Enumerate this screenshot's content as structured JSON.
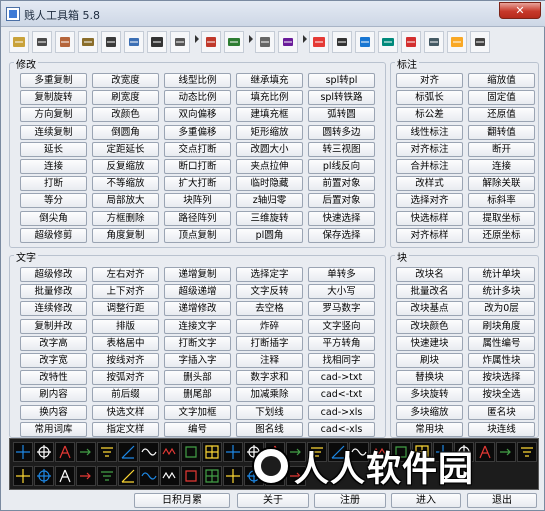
{
  "window": {
    "title": "贱人工具箱 5.8",
    "close_glyph": "✕"
  },
  "toolbar": {
    "icons": [
      "open-folder-icon",
      "print-icon",
      "stamp-icon",
      "lock-icon",
      "printer-icon",
      "calculator-icon",
      "zoom-icon",
      "ruler-icon",
      "layer-icon",
      "export-icon",
      "dimension-icon",
      "mark-icon",
      "color-palette-icon",
      "edit-icon",
      "screen-icon",
      "book-icon",
      "magnet-icon",
      "crosshair-icon",
      "gear-icon",
      "keyboard-icon"
    ]
  },
  "sections": {
    "modify": {
      "title": "修改",
      "rows": [
        [
          "多重复制",
          "改宽度",
          "线型比例",
          "继承填充",
          "spl转pl"
        ],
        [
          "复制旋转",
          "刷宽度",
          "动态比例",
          "填充比例",
          "spl转铁路"
        ],
        [
          "方向复制",
          "改颜色",
          "双向偏移",
          "建填充框",
          "弧转圆"
        ],
        [
          "连续复制",
          "倒圆角",
          "多重偏移",
          "矩形缩放",
          "圆转多边"
        ],
        [
          "延长",
          "定距延长",
          "交点打断",
          "改圆大小",
          "转三视图"
        ],
        [
          "连接",
          "反复缩放",
          "断口打断",
          "夹点拉伸",
          "pl线反向"
        ],
        [
          "打断",
          "不等缩放",
          "扩大打断",
          "临时隐藏",
          "前置对象"
        ],
        [
          "等分",
          "局部放大",
          "块阵列",
          "z轴归零",
          "后置对象"
        ],
        [
          "倒尖角",
          "方框删除",
          "路径阵列",
          "三维旋转",
          "快速选择"
        ],
        [
          "超级修剪",
          "角度复制",
          "顶点复制",
          "pl圆角",
          "保存选择"
        ]
      ]
    },
    "annotate": {
      "title": "标注",
      "rows": [
        [
          "对齐",
          "缩放值"
        ],
        [
          "标弧长",
          "固定值"
        ],
        [
          "标公差",
          "还原值"
        ],
        [
          "线性标注",
          "翻转值"
        ],
        [
          "对齐标注",
          "断开"
        ],
        [
          "合并标注",
          "连接"
        ],
        [
          "改样式",
          "解除关联"
        ],
        [
          "选择对齐",
          "标斜率"
        ],
        [
          "快选标样",
          "提取坐标"
        ],
        [
          "对齐标样",
          "还原坐标"
        ]
      ]
    },
    "text": {
      "title": "文字",
      "rows": [
        [
          "超级修改",
          "左右对齐",
          "递增复制",
          "选择定字",
          "单转多"
        ],
        [
          "批量修改",
          "上下对齐",
          "超级递增",
          "文字反转",
          "大小写"
        ],
        [
          "连续修改",
          "调整行距",
          "递增修改",
          "去空格",
          "罗马数字"
        ],
        [
          "复制并改",
          "排版",
          "连接文字",
          "炸碎",
          "文字竖向"
        ],
        [
          "改字高",
          "表格居中",
          "打断文字",
          "打断插字",
          "平方转角"
        ],
        [
          "改字宽",
          "按线对齐",
          "字插入字",
          "注释",
          "找相同字"
        ],
        [
          "改特性",
          "按弧对齐",
          "删头部",
          "数字求和",
          "cad->txt"
        ],
        [
          "刷内容",
          "前后缀",
          "删尾部",
          "加减乘除",
          "cad<-txt"
        ],
        [
          "换内容",
          "快选文样",
          "文字加框",
          "下划线",
          "cad->xls"
        ],
        [
          "常用词库",
          "指定文样",
          "编号",
          "图名线",
          "cad<-xls"
        ]
      ]
    },
    "block": {
      "title": "块",
      "rows": [
        [
          "改块名",
          "统计单块"
        ],
        [
          "批量改名",
          "统计多块"
        ],
        [
          "改块基点",
          "改为0层"
        ],
        [
          "改块颜色",
          "刷块角度"
        ],
        [
          "快速建块",
          "属性编号"
        ],
        [
          "刷块",
          "炸属性块"
        ],
        [
          "替换块",
          "按块选择"
        ],
        [
          "多块旋转",
          "按块全选"
        ],
        [
          "多块缩放",
          "匿名块"
        ],
        [
          "常用块",
          "块连线"
        ]
      ]
    }
  },
  "symbols": {
    "row1": [
      "axis-symbol-icon",
      "target-symbol-icon",
      "tree-symbol-icon",
      "arrow-symbol-icon",
      "ground-symbol-icon",
      "angle-symbol-icon",
      "sine-symbol-icon",
      "wave-symbol-icon",
      "box-symbol-icon",
      "grid-symbol-icon",
      "zigzag-symbol-icon",
      "callout-symbol-icon",
      "tag-symbol-icon",
      "leaf-symbol-icon",
      "frame-symbol-icon",
      "cross-symbol-icon",
      "diamond-symbol-icon",
      "hatch-symbol-icon",
      "label-symbol-icon",
      "line-symbol-icon",
      "spring-symbol-icon",
      "dot-symbol-icon",
      "bracket-symbol-icon",
      "plus-symbol-icon",
      "loop-symbol-icon"
    ],
    "row2": [
      "spring2-symbol-icon",
      "wave2-symbol-icon",
      "circle-symbol-icon",
      "pump-symbol-icon",
      "valve-symbol-icon",
      "tank-symbol-icon",
      "gauge-symbol-icon",
      "mesh-symbol-icon",
      "fill-symbol-icon",
      "cell-symbol-icon",
      "section-symbol-icon",
      "text-symbol-icon",
      "north-symbol-icon",
      "dim-symbol-icon"
    ]
  },
  "bottom": {
    "btn1": "日积月累",
    "btn2": "关于",
    "btn3": "注册",
    "btn4": "进入",
    "btn5": "退出"
  },
  "watermark": {
    "text": "人人软件园"
  }
}
